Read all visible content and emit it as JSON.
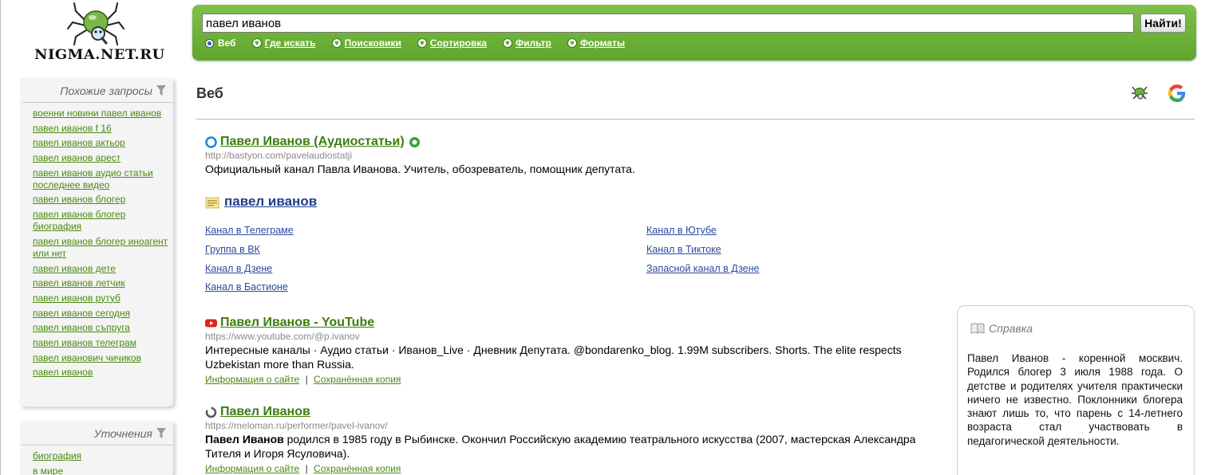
{
  "logo": {
    "text": "NIGMA.NET.RU"
  },
  "search": {
    "query": "павел иванов",
    "button_label": "Найти!",
    "options": [
      {
        "label": "Веб",
        "type": "radio"
      },
      {
        "label": "Где искать",
        "type": "dropdown"
      },
      {
        "label": "Поисковики",
        "type": "dropdown"
      },
      {
        "label": "Сортировка",
        "type": "dropdown"
      },
      {
        "label": "Фильтр",
        "type": "dropdown"
      },
      {
        "label": "Форматы",
        "type": "dropdown"
      }
    ]
  },
  "sidebar": {
    "related": {
      "title": "Похожие запросы",
      "items": [
        "военни новини павел иванов",
        "павел иванов f 16",
        "павел иванов актьор",
        "павел иванов арест",
        "павел иванов аудио статьи последнее видео",
        "павел иванов блогер",
        "павел иванов блогер биография",
        "павел иванов блогер иноагент или нет",
        "павел иванов дете",
        "павел иванов летчик",
        "павел иванов рутуб",
        "павел иванов сегодня",
        "павел иванов съпруга",
        "павел иванов телеграм",
        "павел иванович чичиков",
        "павел иванов"
      ]
    },
    "refine": {
      "title": "Уточнения",
      "items": [
        "биография",
        "в мире"
      ]
    }
  },
  "main": {
    "heading": "Веб",
    "results": [
      {
        "title": "Павел Иванов (Аудиостатьи)",
        "url": "http://bastyon.com/pavelaudiostatji",
        "desc": "Официальный канал Павла Иванова. Учитель, обозреватель, помощник депутата."
      },
      {
        "title": "Павел Иванов - YouTube",
        "url": "https://www.youtube.com/@p.ivanov",
        "desc": "Интересные каналы · Аудио статьи · Иванов_Live · Дневник Депутата. @bondarenko_blog. 1.99M subscribers. Shorts. The elite respects Uzbekistan more than Russia.",
        "links": [
          "Информация о сайте",
          "Сохранённая копия"
        ]
      },
      {
        "title": "Павел Иванов",
        "url": "https://meloman.ru/performer/pavel-ivanov/",
        "desc_bold": "Павел Иванов",
        "desc_rest": " родился в 1985 году в Рыбинске. Окончил Российскую академию театрального искусства (2007, мастерская Александра Тителя и Игоря Ясуловича).",
        "links": [
          "Информация о сайте",
          "Сохранённая копия"
        ]
      }
    ],
    "feed": {
      "title": "павел иванов",
      "left_links": [
        "Канал в Телеграме",
        "Группа в ВК",
        "Канал в Дзене",
        "Канал в Бастионе"
      ],
      "right_links": [
        "Канал в Ютубе",
        "Канал в Тиктоке",
        "Запасной канал в Дзене"
      ]
    },
    "separator": "|"
  },
  "help": {
    "title": "Справка",
    "text": "Павел Иванов - коренной москвич. Родился блогер 3 июля 1988 года. О детстве и родителях учителя практически ничего не известно. Поклонники блогера знают лишь то, что парень с 14-летнего возраста стал участвовать в педагогической деятельности."
  },
  "colors": {
    "panel_green": "#6cb238",
    "link_green": "#4a8a10",
    "title_green": "#3c7d0f",
    "feed_blue": "#1f3c8c",
    "url_gray": "#8a8a8a"
  }
}
